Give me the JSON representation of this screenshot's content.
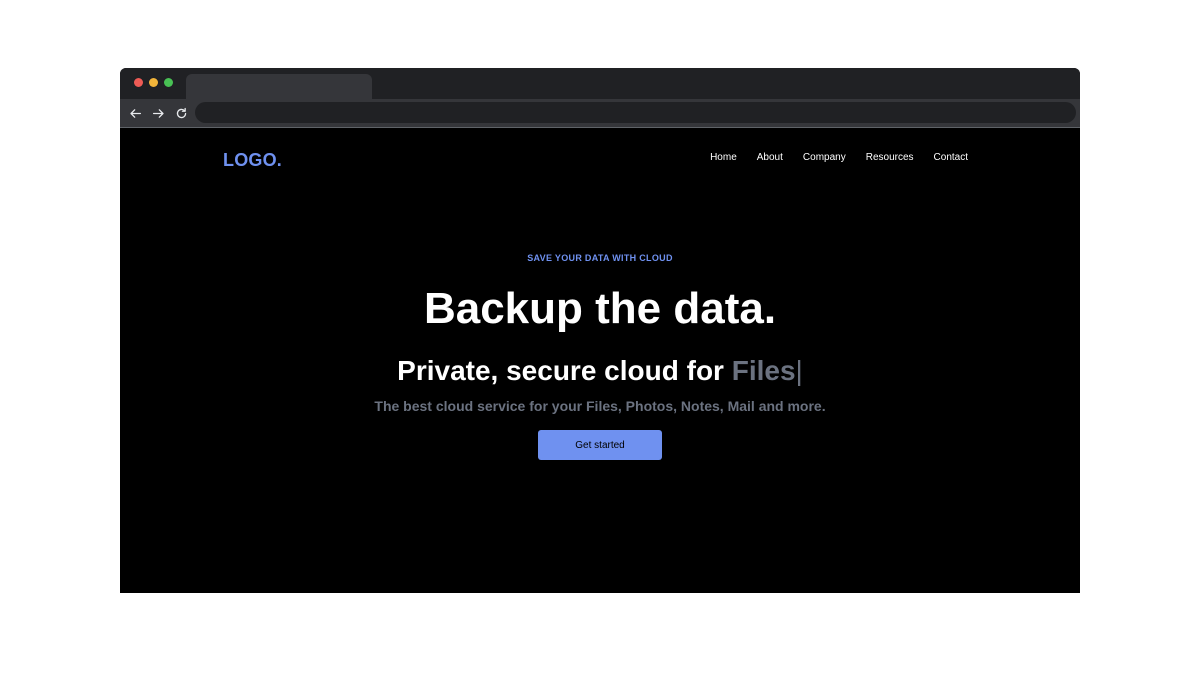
{
  "browser": {
    "window_controls": {
      "close_color": "#ee5b55",
      "minimize_color": "#f2b53a",
      "zoom_color": "#48c154"
    },
    "toolbar_icons": [
      "back-arrow-icon",
      "forward-arrow-icon",
      "reload-icon"
    ],
    "address": ""
  },
  "site": {
    "logo": "LOGO.",
    "accent_color": "#6f91f0",
    "nav": [
      "Home",
      "About",
      "Company",
      "Resources",
      "Contact"
    ]
  },
  "hero": {
    "eyebrow": "SAVE YOUR DATA WITH CLOUD",
    "headline": "Backup the data.",
    "subhead_prefix": "Private, secure cloud for",
    "typed_word": "Files",
    "cursor": "|",
    "tagline": "The best cloud service for your Files, Photos, Notes, Mail and more.",
    "cta_label": "Get started"
  }
}
